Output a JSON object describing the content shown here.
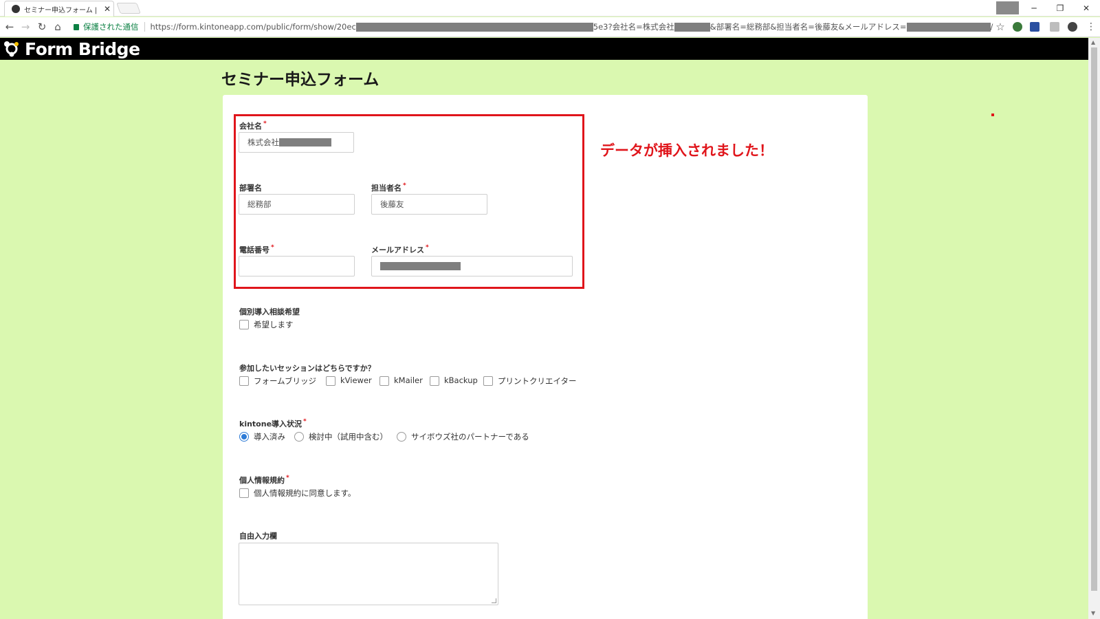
{
  "browser": {
    "tab_title": "セミナー申込フォーム | フォーム",
    "tab_close": "✕",
    "secure_label": "保護された通信",
    "url_prefix": "https://form.kintoneapp.com/public/form/show/20ec",
    "url_mid": "5e3?会社名=株式会社",
    "url_mid2": "&部署名=総務部&担当者名=後藤友&メールアドレス=",
    "url_suffix": "/",
    "back_icon": "arrow-left-icon",
    "forward_icon": "arrow-right-icon",
    "reload_icon": "reload-icon",
    "home_icon": "home-icon",
    "star_icon": "star-icon",
    "minimize": "─",
    "restore": "❐",
    "close": "✕",
    "menu": "⋮",
    "back_glyph": "←",
    "forward_glyph": "→",
    "reload_glyph": "↻",
    "home_glyph": "⌂",
    "star_glyph": "☆"
  },
  "header": {
    "brand": "Form Bridge"
  },
  "form": {
    "title": "セミナー申込フォーム",
    "annotation": "データが挿入されました！",
    "company": {
      "label": "会社名",
      "required": "*",
      "value": "株式会社"
    },
    "department": {
      "label": "部署名",
      "value": "総務部"
    },
    "contact_person": {
      "label": "担当者名",
      "required": "*",
      "value": "後藤友"
    },
    "phone": {
      "label": "電話番号",
      "required": "*",
      "value": ""
    },
    "email": {
      "label": "メールアドレス",
      "required": "*"
    },
    "consultation": {
      "label": "個別導入相談希望",
      "option": "希望します"
    },
    "sessions": {
      "label": "参加したいセッションはどちらですか？",
      "options": [
        "フォームブリッジ",
        "kViewer",
        "kMailer",
        "kBackup",
        "プリントクリエイター"
      ]
    },
    "kintone_status": {
      "label": "kintone導入状況",
      "required": "*",
      "options": [
        "導入済み",
        "検討中（試用中含む）",
        "サイボウズ社のパートナーである"
      ],
      "selected": "導入済み"
    },
    "privacy": {
      "label": "個人情報規約",
      "required": "*",
      "option": "個人情報規約に同意します。"
    },
    "free_input": {
      "label": "自由入力欄",
      "value": ""
    }
  },
  "colors": {
    "page_background": "#daf8b0",
    "highlight": "#e0151b",
    "radio_selected": "#2e7bd6",
    "header_background": "#000000"
  }
}
